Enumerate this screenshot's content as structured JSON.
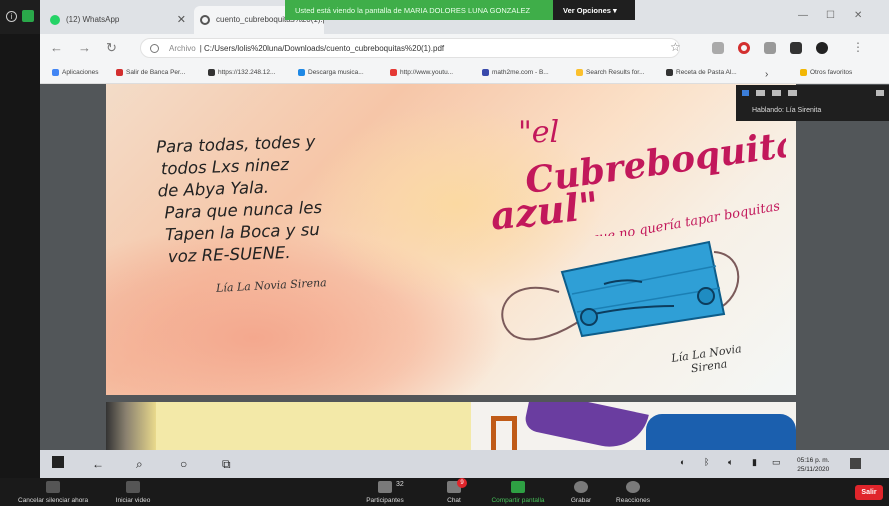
{
  "zoom": {
    "share_banner": "Usted está viendo la pantalla de MARIA DOLORES LUNA GONZALEZ",
    "view_options": "Ver Opciones",
    "speaking": "Hablando: Lía Sirenita",
    "participants_count": "32",
    "chat_badge": "9",
    "toolbar": [
      {
        "name": "mute",
        "label": "Cancelar silenciar ahora",
        "color": "#555555"
      },
      {
        "name": "video",
        "label": "Iniciar video",
        "color": "#555555"
      },
      {
        "name": "participants",
        "label": "Participantes",
        "color": "#7a7a7a"
      },
      {
        "name": "chat",
        "label": "Chat",
        "color": "#7a7a7a"
      },
      {
        "name": "share",
        "label": "Compartir pantalla",
        "color": "#2ea043"
      },
      {
        "name": "record",
        "label": "Grabar",
        "color": "#7a7a7a"
      },
      {
        "name": "reactions",
        "label": "Reacciones",
        "color": "#7a7a7a"
      }
    ],
    "leave_label": "Salir"
  },
  "chrome": {
    "tabs": [
      {
        "title": "(12) WhatsApp",
        "icon_color": "#25d366"
      },
      {
        "title": "cuento_cubreboquitas%20(1).pdf",
        "icon_color": "#555555"
      }
    ],
    "url_scheme": "Archivo",
    "url": "C:/Users/lolis%20luna/Downloads/cuento_cubreboquitas%20(1).pdf",
    "bookmarks": [
      {
        "label": "Aplicaciones",
        "color": "#4285f4"
      },
      {
        "label": "Salir de Banca Per...",
        "color": "#d32f2f"
      },
      {
        "label": "https://132.248.12...",
        "color": "#333333"
      },
      {
        "label": "Descarga musica...",
        "color": "#1e88e5"
      },
      {
        "label": "http://www.youtu...",
        "color": "#e53935"
      },
      {
        "label": "math2me.com - B...",
        "color": "#3949ab"
      },
      {
        "label": "Search Results for...",
        "color": "#fbc02d"
      },
      {
        "label": "Receta de Pasta Al...",
        "color": "#333333"
      },
      {
        "label": "Otros favoritos",
        "color": "#f2b705"
      }
    ]
  },
  "document": {
    "poem_lines": [
      "Para todas, todes y",
      "todos Lxs ninez",
      "de Abya Yala.",
      "Para que nunca les",
      "Tapen la Boca y su",
      "voz RE-SUENE."
    ],
    "poem_signature": "Lía La Novia Sirena",
    "title_line1": "\"el",
    "title_line2": "Cubreboquitas",
    "title_line3": "azul\"",
    "subtitle": "que no quería tapar boquitas",
    "illustration_signature_l1": "Lía La Novia",
    "illustration_signature_l2": "Sirena"
  },
  "taskbar": {
    "time": "05:16 p. m.",
    "date": "25/11/2020"
  }
}
